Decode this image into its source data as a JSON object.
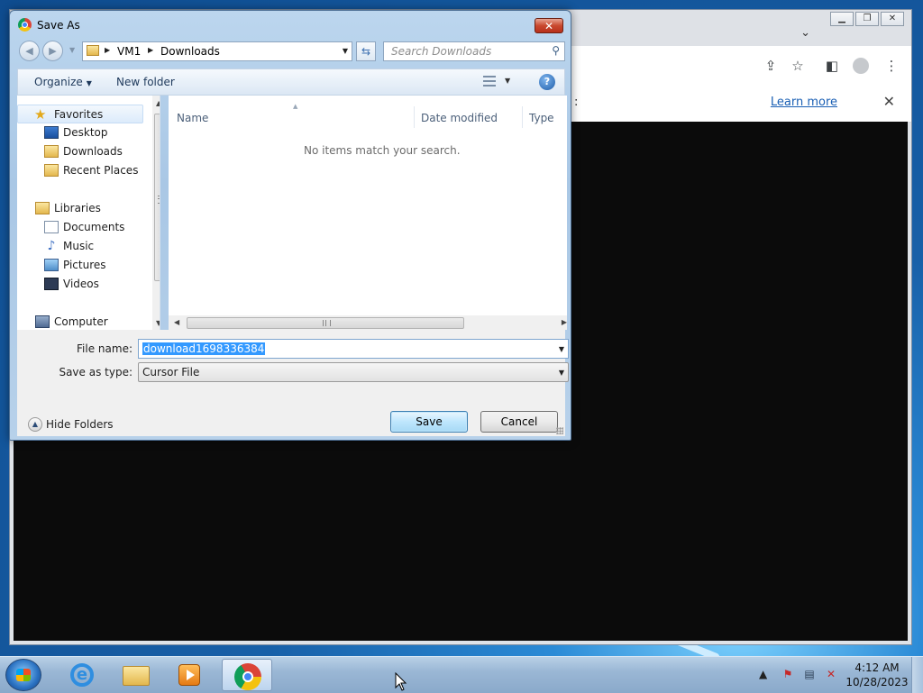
{
  "chrome": {
    "learn_more": "Learn more",
    "infobar_text": ":"
  },
  "dialog": {
    "title": "Save As",
    "breadcrumb": [
      "VM1",
      "Downloads"
    ],
    "search_placeholder": "Search Downloads",
    "toolbar": {
      "organize": "Organize",
      "new_folder": "New folder"
    },
    "nav": {
      "favorites": "Favorites",
      "favorites_items": [
        "Desktop",
        "Downloads",
        "Recent Places"
      ],
      "libraries": "Libraries",
      "libraries_items": [
        "Documents",
        "Music",
        "Pictures",
        "Videos"
      ],
      "computer": "Computer"
    },
    "columns": [
      "Name",
      "Date modified",
      "Type"
    ],
    "empty_message": "No items match your search.",
    "file_name_label": "File name:",
    "file_name_value": "download1698336384",
    "save_as_type_label": "Save as type:",
    "save_as_type_value": "Cursor File",
    "hide_folders": "Hide Folders",
    "save_button": "Save",
    "cancel_button": "Cancel"
  },
  "taskbar": {
    "time": "4:12 AM",
    "date": "10/28/2023"
  },
  "icons": [
    "chrome-icon",
    "back-icon",
    "forward-icon",
    "folder-icon",
    "refresh-icon",
    "search-icon",
    "view-icon",
    "help-icon",
    "star-icon",
    "desktop-icon",
    "music-icon",
    "pictures-icon",
    "videos-icon",
    "computer-icon",
    "start-icon",
    "ie-icon",
    "explorer-icon",
    "media-player-icon",
    "flag-icon",
    "network-icon",
    "volume-muted-icon"
  ]
}
